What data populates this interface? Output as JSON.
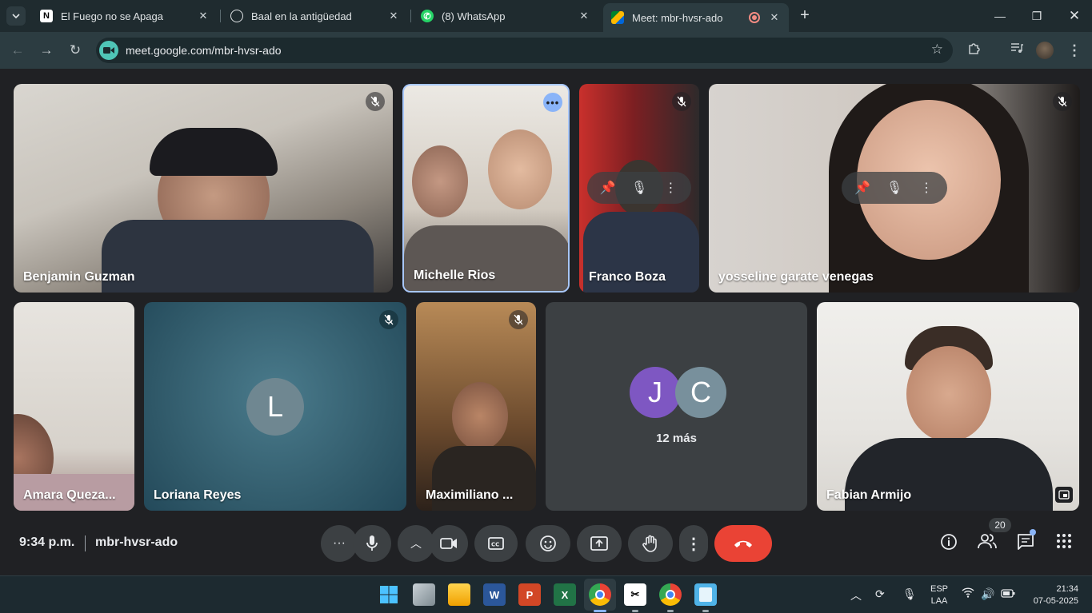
{
  "browser": {
    "tabs": [
      {
        "title": "El Fuego no se Apaga",
        "icon": "notion-icon"
      },
      {
        "title": "Baal en la antigüedad",
        "icon": "chatgpt-icon"
      },
      {
        "title": "(8) WhatsApp",
        "icon": "whatsapp-icon"
      },
      {
        "title": "Meet: mbr-hvsr-ado",
        "icon": "meet-icon"
      }
    ],
    "url": "meet.google.com/mbr-hvsr-ado"
  },
  "participants": [
    {
      "name": "Benjamin Guzman"
    },
    {
      "name": "Michelle Rios"
    },
    {
      "name": "Franco Boza"
    },
    {
      "name": "yosseline garate venegas"
    },
    {
      "name": "Amara Queza..."
    },
    {
      "name": "Loriana Reyes",
      "initial": "L",
      "avatar_color": "#6f8791"
    },
    {
      "name": "Maximiliano ..."
    },
    {
      "name": "Fabian Armijo"
    }
  ],
  "others": {
    "initials": [
      "J",
      "C"
    ],
    "colors": [
      "#7e57c2",
      "#78909c"
    ],
    "label": "12 más"
  },
  "meetbar": {
    "time": "9:34 p.m.",
    "code": "mbr-hvsr-ado",
    "people_count": "20"
  },
  "taskbar": {
    "lang_top": "ESP",
    "lang_bottom": "LAA",
    "clock_time": "21:34",
    "clock_date": "07-05-2025"
  },
  "colors": {
    "end_call": "#ea4335",
    "accent": "#8ab4f8"
  }
}
